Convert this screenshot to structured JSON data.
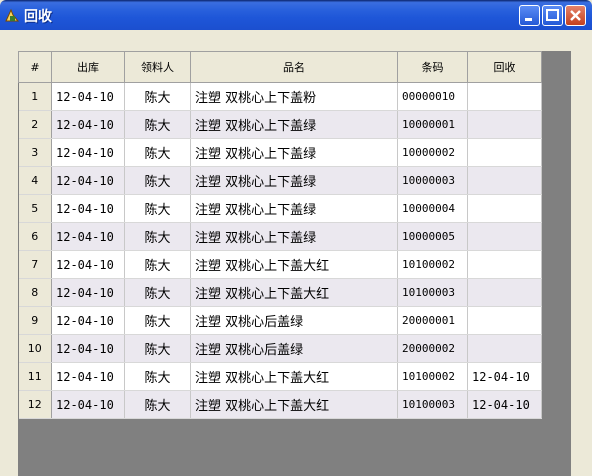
{
  "window": {
    "title": "回收"
  },
  "grid": {
    "columns": [
      "#",
      "出库",
      "领料人",
      "品名",
      "条码",
      "回收"
    ],
    "rows": [
      {
        "num": "1",
        "date": "12-04-10",
        "person": "陈大",
        "name": "注塑 双桃心上下盖粉",
        "code": "00000010",
        "recycle": ""
      },
      {
        "num": "2",
        "date": "12-04-10",
        "person": "陈大",
        "name": "注塑 双桃心上下盖绿",
        "code": "10000001",
        "recycle": ""
      },
      {
        "num": "3",
        "date": "12-04-10",
        "person": "陈大",
        "name": "注塑 双桃心上下盖绿",
        "code": "10000002",
        "recycle": ""
      },
      {
        "num": "4",
        "date": "12-04-10",
        "person": "陈大",
        "name": "注塑 双桃心上下盖绿",
        "code": "10000003",
        "recycle": ""
      },
      {
        "num": "5",
        "date": "12-04-10",
        "person": "陈大",
        "name": "注塑 双桃心上下盖绿",
        "code": "10000004",
        "recycle": ""
      },
      {
        "num": "6",
        "date": "12-04-10",
        "person": "陈大",
        "name": "注塑 双桃心上下盖绿",
        "code": "10000005",
        "recycle": ""
      },
      {
        "num": "7",
        "date": "12-04-10",
        "person": "陈大",
        "name": "注塑 双桃心上下盖大红",
        "code": "10100002",
        "recycle": ""
      },
      {
        "num": "8",
        "date": "12-04-10",
        "person": "陈大",
        "name": "注塑 双桃心上下盖大红",
        "code": "10100003",
        "recycle": ""
      },
      {
        "num": "9",
        "date": "12-04-10",
        "person": "陈大",
        "name": "注塑 双桃心后盖绿",
        "code": "20000001",
        "recycle": ""
      },
      {
        "num": "10",
        "date": "12-04-10",
        "person": "陈大",
        "name": "注塑 双桃心后盖绿",
        "code": "20000002",
        "recycle": ""
      },
      {
        "num": "11",
        "date": "12-04-10",
        "person": "陈大",
        "name": "注塑 双桃心上下盖大红",
        "code": "10100002",
        "recycle": "12-04-10"
      },
      {
        "num": "12",
        "date": "12-04-10",
        "person": "陈大",
        "name": "注塑 双桃心上下盖大红",
        "code": "10100003",
        "recycle": "12-04-10"
      }
    ]
  }
}
